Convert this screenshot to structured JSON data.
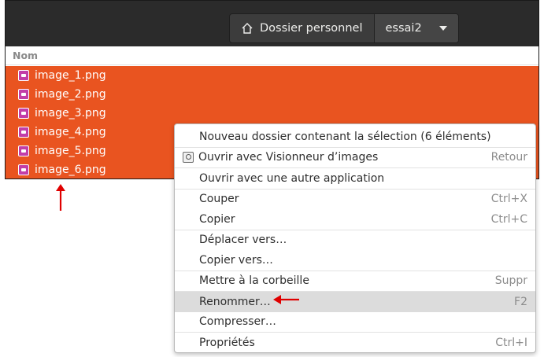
{
  "pathbar": {
    "home_icon": "home-icon",
    "home_label": "Dossier personnel",
    "current_folder": "essai2"
  },
  "list": {
    "column_name": "Nom",
    "files": [
      "image_1.png",
      "image_2.png",
      "image_3.png",
      "image_4.png",
      "image_5.png",
      "image_6.png"
    ]
  },
  "menu": {
    "new_folder_with_selection": "Nouveau dossier contenant la sélection (6 éléments)",
    "open_with_viewer": "Ouvrir avec Visionneur d’images",
    "open_with_viewer_accel": "Retour",
    "open_with_other": "Ouvrir avec une autre application",
    "cut": "Couper",
    "cut_accel": "Ctrl+X",
    "copy": "Copier",
    "copy_accel": "Ctrl+C",
    "move_to": "Déplacer vers…",
    "copy_to": "Copier vers…",
    "trash": "Mettre à la corbeille",
    "trash_accel": "Suppr",
    "rename": "Renommer…",
    "rename_accel": "F2",
    "compress": "Compresser…",
    "properties": "Propriétés",
    "properties_accel": "Ctrl+I"
  },
  "colors": {
    "selection": "#e95420",
    "headerbar": "#2b2b2b",
    "annotation_arrow": "#e00000"
  }
}
